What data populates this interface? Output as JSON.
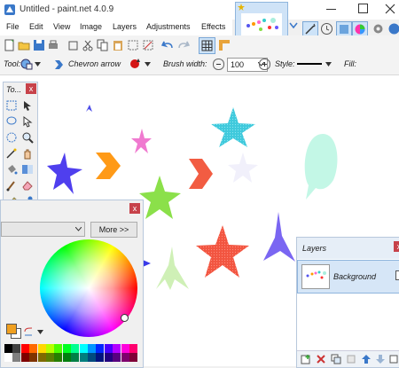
{
  "app": {
    "title": "Untitled - paint.net 4.0.9"
  },
  "menu": {
    "file": "File",
    "edit": "Edit",
    "view": "View",
    "image": "Image",
    "layers": "Layers",
    "adjustments": "Adjustments",
    "effects": "Effects"
  },
  "toolbar2": {
    "tool_label": "Tool:",
    "shape_name": "Chevron arrow",
    "brush_width_label": "Brush width:",
    "brush_width_value": "100",
    "style_label": "Style:",
    "fill_label": "Fill:"
  },
  "tools_panel": {
    "title": "To..."
  },
  "colors_panel": {
    "more_button": "More >>"
  },
  "layers_panel": {
    "title": "Layers",
    "layer_name": "Background"
  },
  "colors": {
    "accent": "#5b9bd5",
    "close_red": "#c7424a",
    "primary": "#000000",
    "secondary": "#ffffff"
  },
  "palette": [
    "#000000",
    "#404040",
    "#ff0000",
    "#ff6a00",
    "#ffd800",
    "#b6ff00",
    "#4cff00",
    "#00ff21",
    "#00ff90",
    "#00ffff",
    "#0094ff",
    "#0026ff",
    "#4800ff",
    "#b200ff",
    "#ff00dc",
    "#ff006e",
    "#ffffff",
    "#808080",
    "#7f0000",
    "#7f3300",
    "#7f6a00",
    "#5b7f00",
    "#267f00",
    "#007f0e",
    "#007f46",
    "#007f7f",
    "#004a7f",
    "#00137f",
    "#21007f",
    "#57007f",
    "#7f006e",
    "#7f0037"
  ]
}
